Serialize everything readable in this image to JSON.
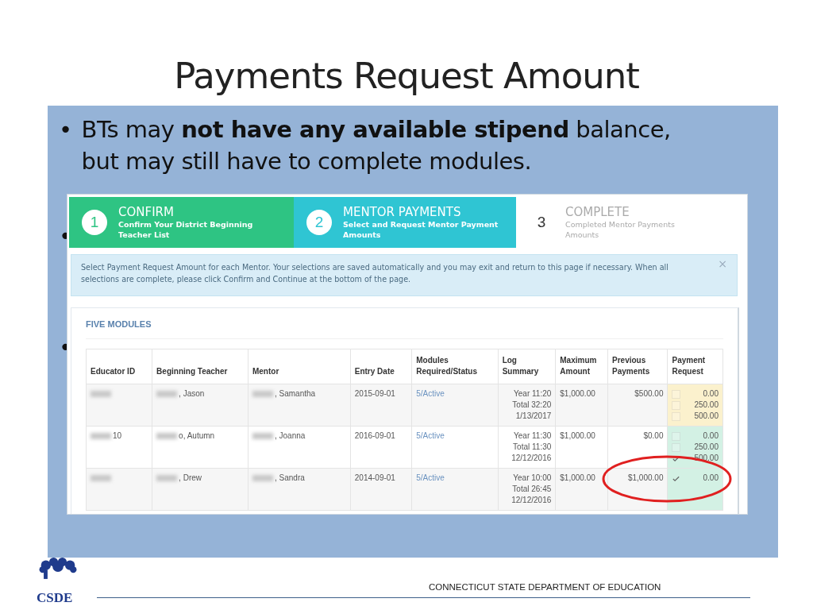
{
  "slide": {
    "title": "Payments Request Amount",
    "bullets": [
      {
        "marker": "•",
        "text": "BTs may **not have any available stipend** balance, but may still have to complete modules."
      },
      {
        "marker": "•"
      },
      {
        "marker": "•"
      }
    ]
  },
  "screenshot": {
    "steps": [
      {
        "number": "1",
        "title": "CONFIRM",
        "subtitle": "Confirm Your District Beginning Teacher List",
        "completed": true,
        "selected": false
      },
      {
        "number": "2",
        "title": "MENTOR PAYMENTS",
        "subtitle": "Select and Request Mentor Payment Amounts",
        "completed": false,
        "selected": true
      },
      {
        "number": "3",
        "title": "COMPLETE",
        "subtitle": "Completed Mentor Payments Amounts",
        "completed": false,
        "selected": false
      }
    ],
    "alert": {
      "text": "Select Payment Request Amount for each Mentor. Your selections are saved automatically and you may exit and return to this page if necessary. When all selections are complete, please click Confirm and Continue at the bottom of the page.",
      "close": "×"
    },
    "section_title": "FIVE MODULES",
    "table": {
      "columns": [
        "Educator ID",
        "Beginning Teacher",
        "Mentor",
        "Entry Date",
        "Modules Required/Status",
        "Log Summary",
        "Maximum Amount",
        "Previous Payments",
        "Payment Request"
      ],
      "rows": [
        {
          "educator_id": {
            "redacted": true
          },
          "teacher": {
            "text": ", Jason",
            "redacted": true
          },
          "mentor": {
            "text": ", Samantha",
            "redacted": true
          },
          "entry_date": "2015-09-01",
          "modules": "5/Active",
          "log": [
            "Year 11:20",
            "Total 32:20",
            "1/13/2017"
          ],
          "maximum": "$1,000.00",
          "previous": "$500.00",
          "complete": false,
          "options": [
            {
              "amount": "0.00",
              "checked": false
            },
            {
              "amount": "250.00",
              "checked": false
            },
            {
              "amount": "500.00",
              "checked": false
            }
          ]
        },
        {
          "educator_id": {
            "text": "10",
            "redacted": true
          },
          "teacher": {
            "text": "o, Autumn",
            "redacted": true
          },
          "mentor": {
            "text": ", Joanna",
            "redacted": true
          },
          "entry_date": "2016-09-01",
          "modules": "5/Active",
          "log": [
            "Year 11:30",
            "Total 11:30",
            "12/12/2016"
          ],
          "maximum": "$1,000.00",
          "previous": "$0.00",
          "complete": true,
          "options": [
            {
              "amount": "0.00",
              "checked": false
            },
            {
              "amount": "250.00",
              "checked": false
            },
            {
              "amount": "500.00",
              "checked": true
            }
          ]
        },
        {
          "educator_id": {
            "redacted": true
          },
          "teacher": {
            "text": ", Drew",
            "redacted": true
          },
          "mentor": {
            "text": ", Sandra",
            "redacted": true
          },
          "entry_date": "2014-09-01",
          "modules": "5/Active",
          "log": [
            "Year 10:00",
            "Total 26:45",
            "12/12/2016"
          ],
          "maximum": "$1,000.00",
          "previous": "$1,000.00",
          "complete": true,
          "options": [
            {
              "amount": "0.00",
              "checked": true
            }
          ]
        }
      ]
    },
    "annotation": {
      "kind": "ellipse",
      "color": "#e02020"
    }
  },
  "footer": {
    "logo_text": "CSDE",
    "text": "CONNECTICUT STATE DEPARTMENT OF EDUCATION"
  }
}
